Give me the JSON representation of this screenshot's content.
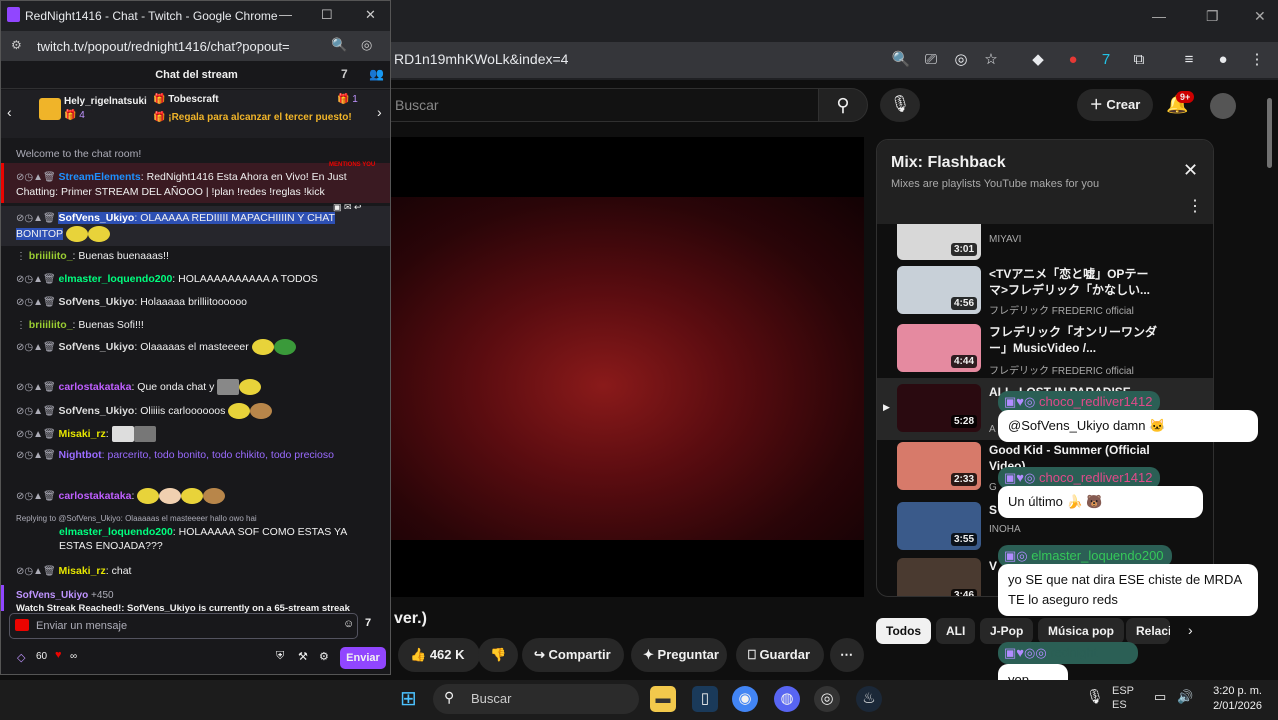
{
  "chrome_bg": {
    "url": "RD1n19mhKWoLk&index=4"
  },
  "youtube": {
    "search_placeholder": "Buscar",
    "create_label": "Crear",
    "notif_badge": "9+",
    "video_title_fragment": "ver.)",
    "actions": {
      "likes": "462 K",
      "share": "Compartir",
      "ask": "Preguntar",
      "save": "Guardar"
    },
    "mix": {
      "title": "Mix: Flashback",
      "subtitle": "Mixes are playlists YouTube makes for you",
      "items": [
        {
          "title": "",
          "channel": "MIYAVI",
          "duration": "3:01"
        },
        {
          "title": "<TVアニメ「恋と嘘」OPテーマ>フレデリック「かなしい...",
          "channel": "フレデリック FREDERIC official",
          "duration": "4:56"
        },
        {
          "title": "フレデリック「オンリーワンダー」MusicVideo /...",
          "channel": "フレデリック FREDERIC official",
          "duration": "4:44"
        },
        {
          "title": "ALI - LOST IN PARADISE ...",
          "channel": "A",
          "duration": "5:28"
        },
        {
          "title": "Good Kid - Summer (Official Video)",
          "channel": "G",
          "duration": "2:33"
        },
        {
          "title": "S",
          "channel": "INOHA",
          "duration": "3:55"
        },
        {
          "title": "V",
          "channel": "",
          "duration": "3:46"
        }
      ]
    },
    "chips": [
      "Todos",
      "ALI",
      "J-Pop",
      "Música pop",
      "Relacio"
    ]
  },
  "overlay": [
    {
      "name": "choco_redliver1412",
      "message": "@SofVens_Ukiyo damn 🐱"
    },
    {
      "name": "choco_redliver1412",
      "message": "Un último 🍌 🐻"
    },
    {
      "name": "elmaster_loquendo200",
      "message": "yo SE que nat dira ESE chiste de MRDA TE lo aseguro reds"
    },
    {
      "name": "rednight",
      "message": "yop"
    }
  ],
  "taskbar": {
    "search": "Buscar",
    "lang": "ESP",
    "region": "ES",
    "time": "3:20 p. m.",
    "date": "2/01/2026"
  },
  "twitch": {
    "window_title": "RedNight1416 - Chat - Twitch - Google Chrome",
    "url": "twitch.tv/popout/rednight1416/chat?popout=",
    "header": "Chat del stream",
    "gift": {
      "user1": "Hely_rigelnatsuki",
      "count1": "4",
      "user2": "Tobescraft",
      "count2": "1",
      "promo": "¡Regala para alcanzar el tercer puesto!"
    },
    "welcome": "Welcome to the chat room!",
    "mention_tag": "MENTIONS YOU",
    "lines": [
      {
        "name": "StreamElements",
        "text": ": RedNight1416 Esta Ahora en Vivo! En Just Chatting: Primer STREAM DEL AÑOOO | !plan !redes !reglas !kick"
      },
      {
        "name": "SofVens_Ukiyo",
        "text": ": OLAAAAA REDIIIII MAPACHIIIIN Y CHAT BONITOP"
      },
      {
        "name": "briiiliito_",
        "text": ": Buenas buenaaas!!"
      },
      {
        "name": "elmaster_loquendo200",
        "text": ": HOLAAAAAAAAAA A TODOS"
      },
      {
        "name": "SofVens_Ukiyo",
        "text": ": Holaaaaa brilliitoooooo"
      },
      {
        "name": "briiiliito_",
        "text": ": Buenas Sofi!!!"
      },
      {
        "name": "SofVens_Ukiyo",
        "text": ": Olaaaaas el masteeeer"
      },
      {
        "name": "carlostakataka",
        "text": ": Que onda chat y"
      },
      {
        "name": "SofVens_Ukiyo",
        "text": ": Oliiiis carloooooos"
      },
      {
        "name": "Misaki_rz",
        "text": ":"
      },
      {
        "name": "Nightbot",
        "text": ": parcerito, todo bonito, todo chikito, todo precioso"
      },
      {
        "name": "carlostakataka",
        "text": ":"
      },
      {
        "name": "elmaster_loquendo200",
        "text": ": HOLAAAAA SOF COMO ESTAS YA ESTAS ENOJADA???"
      },
      {
        "name": "Misaki_rz",
        "text": ": chat"
      }
    ],
    "reply_to": "Replying to @SofVens_Ukiyo: Olaaaaas el masteeeer hallo owo hai",
    "streak_user": "SofVens_Ukiyo",
    "streak_points": "+450",
    "streak_text": "Watch Streak Reached!: SofVens_Ukiyo is currently on a 65-stream streak",
    "input_placeholder": "Enviar un mensaje",
    "points": "60",
    "infinity": "∞",
    "send": "Enviar"
  }
}
